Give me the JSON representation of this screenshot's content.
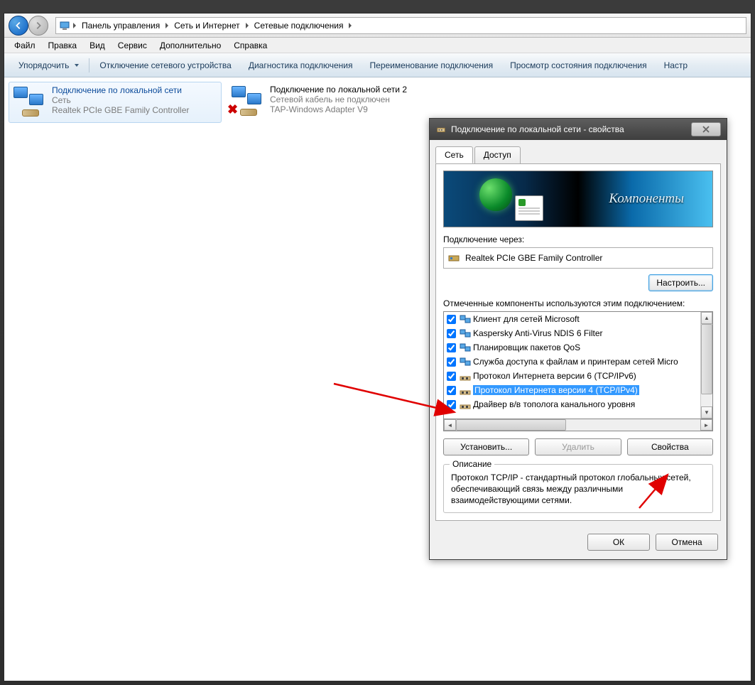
{
  "breadcrumb": {
    "p1": "Панель управления",
    "p2": "Сеть и Интернет",
    "p3": "Сетевые подключения"
  },
  "menu": {
    "file": "Файл",
    "edit": "Правка",
    "view": "Вид",
    "service": "Сервис",
    "extra": "Дополнительно",
    "help": "Справка"
  },
  "toolbar": {
    "organize": "Упорядочить",
    "disable": "Отключение сетевого устройства",
    "diagnose": "Диагностика подключения",
    "rename": "Переименование подключения",
    "status": "Просмотр состояния подключения",
    "settings": "Настр"
  },
  "connections": [
    {
      "name": "Подключение по локальной сети",
      "status": "Сеть",
      "device": "Realtek PCIe GBE Family Controller",
      "selected": true,
      "disconnected": false
    },
    {
      "name": "Подключение по локальной сети 2",
      "status": "Сетевой кабель не подключен",
      "device": "TAP-Windows Adapter V9",
      "selected": false,
      "disconnected": true
    }
  ],
  "dialog": {
    "title": "Подключение по локальной сети - свойства",
    "tabs": {
      "net": "Сеть",
      "access": "Доступ"
    },
    "banner": "Компоненты",
    "via_label": "Подключение через:",
    "adapter": "Realtek PCIe GBE Family Controller",
    "configure": "Настроить...",
    "components_label": "Отмеченные компоненты используются этим подключением:",
    "components": [
      {
        "label": "Клиент для сетей Microsoft",
        "checked": true,
        "icon": "client",
        "selected": false
      },
      {
        "label": "Kaspersky Anti-Virus NDIS 6 Filter",
        "checked": true,
        "icon": "client",
        "selected": false
      },
      {
        "label": "Планировщик пакетов QoS",
        "checked": true,
        "icon": "client",
        "selected": false
      },
      {
        "label": "Служба доступа к файлам и принтерам сетей Micro",
        "checked": true,
        "icon": "client",
        "selected": false
      },
      {
        "label": "Протокол Интернета версии 6 (TCP/IPv6)",
        "checked": true,
        "icon": "proto",
        "selected": false
      },
      {
        "label": "Протокол Интернета версии 4 (TCP/IPv4)",
        "checked": true,
        "icon": "proto",
        "selected": true
      },
      {
        "label": "Драйвер в/в тополога канального уровня",
        "checked": true,
        "icon": "proto",
        "selected": false
      }
    ],
    "install": "Установить...",
    "remove": "Удалить",
    "properties": "Свойства",
    "desc_legend": "Описание",
    "desc_text": "Протокол TCP/IP - стандартный протокол глобальных сетей, обеспечивающий связь между различными взаимодействующими сетями.",
    "ok": "ОК",
    "cancel": "Отмена"
  }
}
